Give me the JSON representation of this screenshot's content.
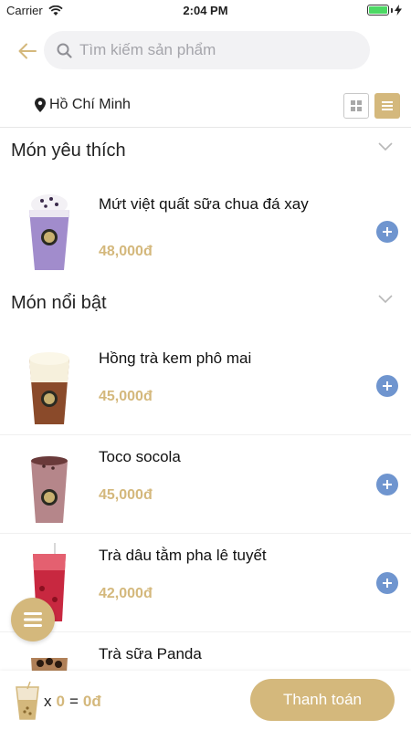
{
  "status_bar": {
    "carrier": "Carrier",
    "time": "2:04 PM"
  },
  "search": {
    "placeholder": "Tìm kiếm sản phẩm"
  },
  "location": {
    "city": "Hồ Chí Minh"
  },
  "view_modes": {
    "active": "list"
  },
  "sections": [
    {
      "title": "Món yêu thích",
      "products": [
        {
          "name": "Mứt việt quất sữa chua đá xay",
          "price": "48,000đ",
          "drink": "blueberry-yogurt-smoothie"
        }
      ]
    },
    {
      "title": "Món nổi bật",
      "products": [
        {
          "name": "Hồng trà kem phô mai",
          "price": "45,000đ",
          "drink": "cheese-foam-black-tea"
        },
        {
          "name": "Toco socola",
          "price": "45,000đ",
          "drink": "chocolate-milk"
        },
        {
          "name": "Trà dâu tằm pha lê tuyết",
          "price": "42,000đ",
          "drink": "mulberry-crystal-tea"
        },
        {
          "name": "Trà sữa Panda",
          "price": "",
          "drink": "panda-milk-tea"
        }
      ]
    }
  ],
  "cart": {
    "multiply": "x",
    "count": "0",
    "equals": "=",
    "total": "0đ",
    "checkout_label": "Thanh toán"
  },
  "colors": {
    "accent": "#d4b87c",
    "add_button": "#6f95cf"
  }
}
